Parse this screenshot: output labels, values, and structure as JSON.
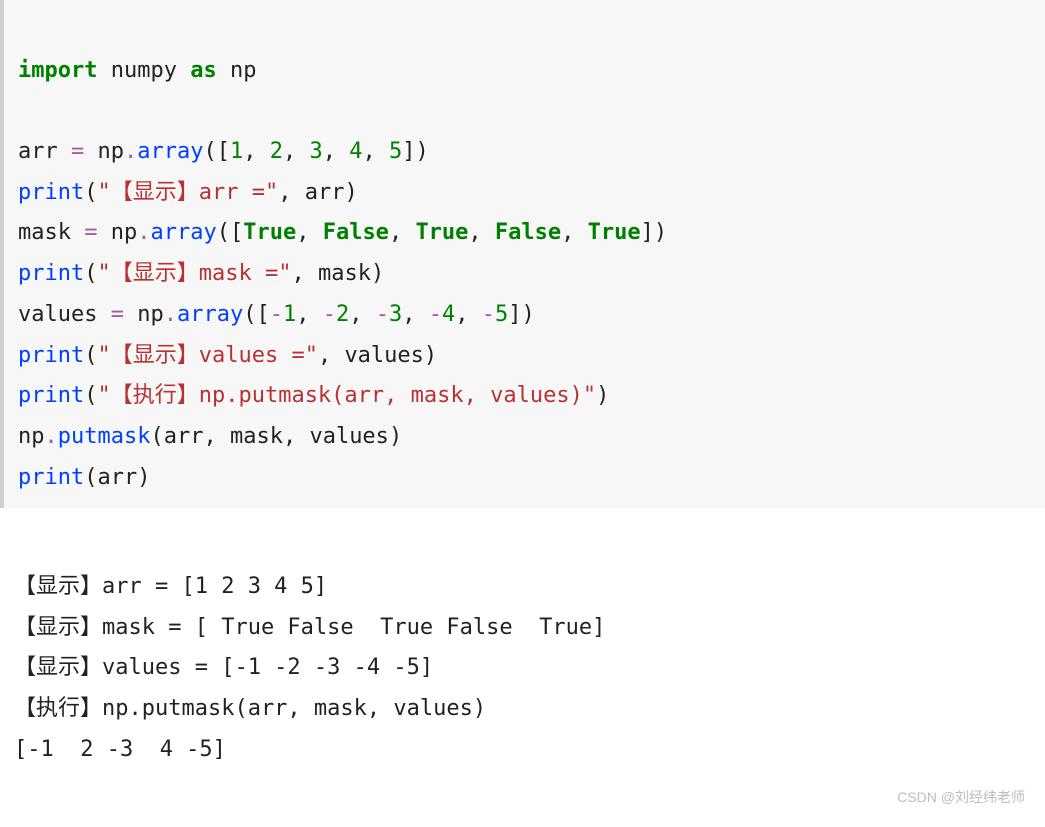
{
  "code": {
    "l1": {
      "import": "import",
      "numpy": "numpy",
      "as": "as",
      "np": "np"
    },
    "l3": {
      "arr": "arr",
      "eq": "=",
      "np": "np",
      "dot": ".",
      "array": "array",
      "lp": "(",
      "lb": "[",
      "v1": "1",
      "v2": "2",
      "v3": "3",
      "v4": "4",
      "v5": "5",
      "rb": "]",
      "rp": ")",
      "c": ", "
    },
    "l4": {
      "print": "print",
      "lp": "(",
      "s": "\"【显示】arr =\"",
      "c": ", ",
      "arr": "arr",
      "rp": ")"
    },
    "l5": {
      "mask": "mask",
      "eq": "=",
      "np": "np",
      "dot": ".",
      "array": "array",
      "lp": "(",
      "lb": "[",
      "t1": "True",
      "f1": "False",
      "t2": "True",
      "f2": "False",
      "t3": "True",
      "rb": "]",
      "rp": ")",
      "c": ", "
    },
    "l6": {
      "print": "print",
      "lp": "(",
      "s": "\"【显示】mask =\"",
      "c": ", ",
      "mask": "mask",
      "rp": ")"
    },
    "l7": {
      "values": "values",
      "eq": "=",
      "np": "np",
      "dot": ".",
      "array": "array",
      "lp": "(",
      "lb": "[",
      "m": "-",
      "v1": "1",
      "v2": "2",
      "v3": "3",
      "v4": "4",
      "v5": "5",
      "rb": "]",
      "rp": ")",
      "c": ", "
    },
    "l8": {
      "print": "print",
      "lp": "(",
      "s": "\"【显示】values =\"",
      "c": ", ",
      "values": "values",
      "rp": ")"
    },
    "l9": {
      "print": "print",
      "lp": "(",
      "s": "\"【执行】np.putmask(arr, mask, values)\"",
      "rp": ")"
    },
    "l10": {
      "np": "np",
      "dot": ".",
      "putmask": "putmask",
      "lp": "(",
      "arr": "arr",
      "c1": ", ",
      "mask": "mask",
      "c2": ", ",
      "values": "values",
      "rp": ")"
    },
    "l11": {
      "print": "print",
      "lp": "(",
      "arr": "arr",
      "rp": ")"
    }
  },
  "output": {
    "l1": "【显示】arr = [1 2 3 4 5]",
    "l2": "【显示】mask = [ True False  True False  True]",
    "l3": "【显示】values = [-1 -2 -3 -4 -5]",
    "l4": "【执行】np.putmask(arr, mask, values)",
    "l5": "[-1  2 -3  4 -5]"
  },
  "watermark": "CSDN @刘经纬老师"
}
